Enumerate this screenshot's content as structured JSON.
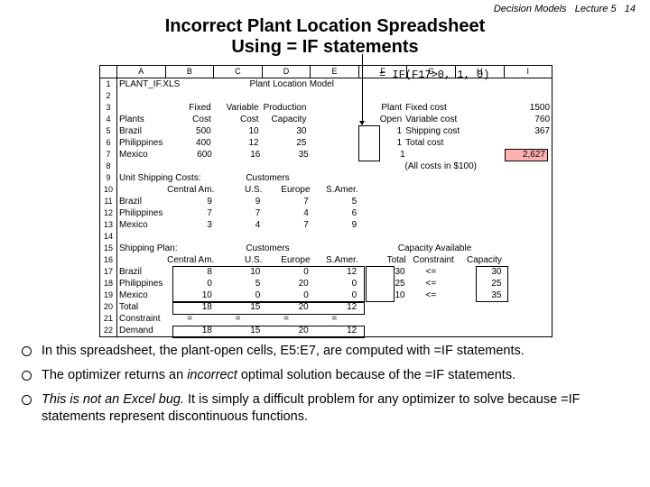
{
  "header": {
    "course": "Decision Models",
    "lecture": "Lecture 5",
    "page": "14"
  },
  "title_line1": "Incorrect Plant Location Spreadsheet",
  "title_line2": "Using  = IF statements",
  "formula": "= IF(F17>0, 1, 0)",
  "cols": [
    "A",
    "B",
    "C",
    "D",
    "E",
    "F",
    "G",
    "H",
    "I"
  ],
  "r1_file": "PLANT_IF.XLS",
  "r1_title": "Plant Location Model",
  "hdr": {
    "b3": "Fixed",
    "c3": "Variable",
    "d3": "Production",
    "f3": "Plant",
    "b4": "Cost",
    "c4": "Cost",
    "d4": "Capacity",
    "f4": "Open",
    "a4": "Plants"
  },
  "plants": [
    {
      "name": "Brazil",
      "fixed": "500",
      "var": "10",
      "cap": "30",
      "open": "1"
    },
    {
      "name": "Philippines",
      "fixed": "400",
      "var": "12",
      "cap": "25",
      "open": "1"
    },
    {
      "name": "Mexico",
      "fixed": "600",
      "var": "16",
      "cap": "35",
      "open": "1"
    }
  ],
  "costs": {
    "fixed_lbl": "Fixed cost",
    "fixed_val": "1500",
    "var_lbl": "Variable cost",
    "var_val": "760",
    "ship_lbl": "Shipping cost",
    "ship_val": "367",
    "total_lbl": "Total cost",
    "total_val": "2,627"
  },
  "cost_note": "(All costs in $100)",
  "shipcost_title": "Unit Shipping Costs:",
  "cust_hdr": "Customers",
  "regions": {
    "b": "Central Am.",
    "c": "U.S.",
    "d": "Europe",
    "e": "S.Amer."
  },
  "ship": [
    {
      "name": "Brazil",
      "b": "9",
      "c": "9",
      "d": "7",
      "e": "5"
    },
    {
      "name": "Philippines",
      "b": "7",
      "c": "7",
      "d": "4",
      "e": "6"
    },
    {
      "name": "Mexico",
      "b": "3",
      "c": "4",
      "d": "7",
      "e": "9"
    }
  ],
  "plan_title": "Shipping Plan:",
  "cap_avail": "Capacity Available",
  "plan_hdr": {
    "f": "Total",
    "g": "Constraint",
    "h": "Capacity"
  },
  "plan": [
    {
      "name": "Brazil",
      "b": "8",
      "c": "10",
      "d": "0",
      "e": "12",
      "f": "30",
      "g": "<=",
      "h": "30"
    },
    {
      "name": "Philippines",
      "b": "0",
      "c": "5",
      "d": "20",
      "e": "0",
      "f": "25",
      "g": "<=",
      "h": "25"
    },
    {
      "name": "Mexico",
      "b": "10",
      "c": "0",
      "d": "0",
      "e": "0",
      "f": "10",
      "g": "<=",
      "h": "35"
    }
  ],
  "totals": {
    "name": "Total",
    "b": "18",
    "c": "15",
    "d": "20",
    "e": "12"
  },
  "constraint": {
    "name": "Constraint",
    "b": "=",
    "c": "=",
    "d": "=",
    "e": "="
  },
  "demand": {
    "name": "Demand",
    "b": "18",
    "c": "15",
    "d": "20",
    "e": "12"
  },
  "bullets": [
    "In this spreadsheet, the plant-open cells, E5:E7, are computed with =IF statements.",
    "The optimizer returns an incorrect optimal solution because of the =IF statements.",
    "This is not an Excel bug. It is simply a difficult problem for any optimizer to solve because =IF statements represent discontinuous functions."
  ],
  "chart_data": {
    "type": "table",
    "title": "Plant Location Model (PLANT_IF.XLS)",
    "plants": [
      {
        "name": "Brazil",
        "fixed_cost": 500,
        "variable_cost": 10,
        "capacity": 30,
        "open": 1
      },
      {
        "name": "Philippines",
        "fixed_cost": 400,
        "variable_cost": 12,
        "capacity": 25,
        "open": 1
      },
      {
        "name": "Mexico",
        "fixed_cost": 600,
        "variable_cost": 16,
        "capacity": 35,
        "open": 1
      }
    ],
    "cost_summary": {
      "fixed": 1500,
      "variable": 760,
      "shipping": 367,
      "total": 2627,
      "units": "$100"
    },
    "unit_shipping_costs": {
      "columns": [
        "Central Am.",
        "U.S.",
        "Europe",
        "S.Amer."
      ],
      "rows": {
        "Brazil": [
          9,
          9,
          7,
          5
        ],
        "Philippines": [
          7,
          7,
          4,
          6
        ],
        "Mexico": [
          3,
          4,
          7,
          9
        ]
      }
    },
    "shipping_plan": {
      "columns": [
        "Central Am.",
        "U.S.",
        "Europe",
        "S.Amer."
      ],
      "rows": {
        "Brazil": [
          8,
          10,
          0,
          12
        ],
        "Philippines": [
          0,
          5,
          20,
          0
        ],
        "Mexico": [
          10,
          0,
          0,
          0
        ]
      },
      "totals": [
        18,
        15,
        20,
        12
      ],
      "demand": [
        18,
        15,
        20,
        12
      ],
      "row_totals": {
        "Brazil": 30,
        "Philippines": 25,
        "Mexico": 10
      },
      "capacity": {
        "Brazil": 30,
        "Philippines": 25,
        "Mexico": 35
      }
    }
  }
}
